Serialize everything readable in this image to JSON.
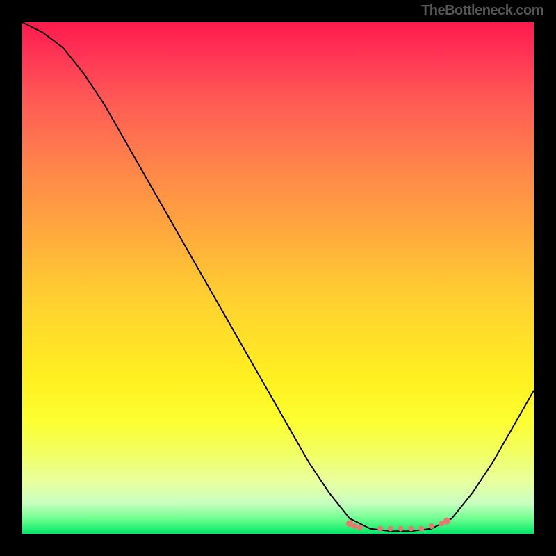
{
  "attribution": "TheBottleneck.com",
  "chart_data": {
    "type": "line",
    "title": "",
    "xlabel": "",
    "ylabel": "",
    "x": [
      0,
      4,
      8,
      12,
      16,
      20,
      24,
      28,
      32,
      36,
      40,
      44,
      48,
      52,
      56,
      60,
      64,
      68,
      72,
      76,
      80,
      84,
      88,
      92,
      96,
      100
    ],
    "values": [
      100,
      98,
      95,
      90,
      84,
      77,
      70,
      63,
      56,
      49,
      42,
      35,
      28,
      21,
      14,
      8,
      3,
      1,
      0.5,
      0.5,
      1,
      3,
      8,
      14,
      21,
      28
    ],
    "xlim": [
      0,
      100
    ],
    "ylim": [
      0,
      100
    ],
    "trough_markers_x": [
      64,
      65,
      66,
      70,
      72,
      74,
      76,
      78,
      80,
      82,
      83
    ],
    "trough_markers_y": [
      2,
      1.5,
      1.2,
      1,
      1,
      1,
      1,
      1,
      1.5,
      2,
      2.5
    ],
    "gradient_stops": [
      {
        "pct": 0,
        "color": "#ff1a4d"
      },
      {
        "pct": 50,
        "color": "#ffd030"
      },
      {
        "pct": 85,
        "color": "#f2ff60"
      },
      {
        "pct": 100,
        "color": "#00e868"
      }
    ]
  }
}
